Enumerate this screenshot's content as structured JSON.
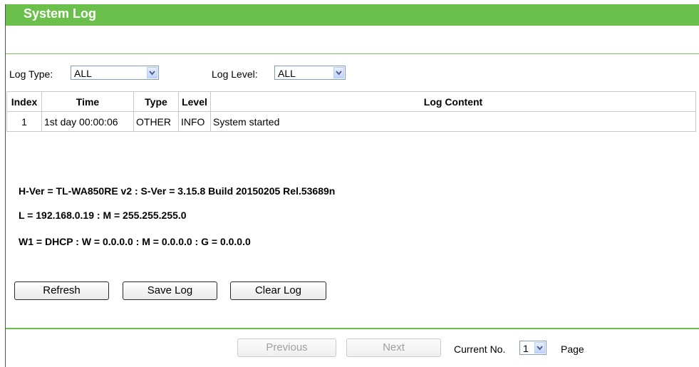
{
  "title": "System Log",
  "filters": {
    "log_type_label": "Log Type:",
    "log_type_value": "ALL",
    "log_level_label": "Log Level:",
    "log_level_value": "ALL"
  },
  "table": {
    "headers": [
      "Index",
      "Time",
      "Type",
      "Level",
      "Log Content"
    ],
    "rows": [
      [
        "1",
        "1st day 00:00:06",
        "OTHER",
        "INFO",
        "System started"
      ]
    ]
  },
  "info": {
    "line1": "H-Ver = TL-WA850RE v2 : S-Ver = 3.15.8 Build 20150205 Rel.53689n",
    "line2": "L = 192.168.0.19 : M = 255.255.255.0",
    "line3": "W1 = DHCP : W = 0.0.0.0 : M = 0.0.0.0 : G = 0.0.0.0"
  },
  "buttons": {
    "refresh": "Refresh",
    "save_log": "Save Log",
    "clear_log": "Clear Log"
  },
  "pager": {
    "previous": "Previous",
    "next": "Next",
    "current_label": "Current No.",
    "current_value": "1",
    "page_label": "Page"
  },
  "colors": {
    "accent": "#6bc04b",
    "border": "#c8c8c8"
  }
}
